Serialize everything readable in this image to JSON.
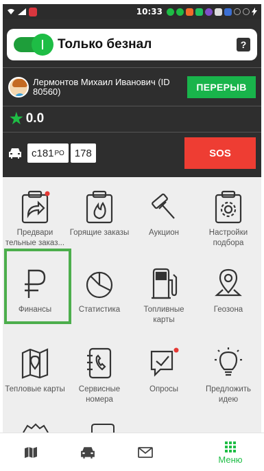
{
  "status": {
    "time": "10:33"
  },
  "toggle": {
    "label": "Только безнал",
    "help": "?"
  },
  "driver": {
    "name": "Лермонтов Михаил Иванович (ID 80560)",
    "break_label": "ПЕРЕРЫВ"
  },
  "rating": {
    "value": "0.0"
  },
  "car": {
    "plate_main": "с181",
    "plate_suffix": "РО",
    "plate_number": "178",
    "sos_label": "SOS"
  },
  "menu": {
    "items": [
      {
        "label": "Предвари тельные заказ...",
        "icon": "clipboard-arrow-icon",
        "badge": true
      },
      {
        "label": "Горящие заказы",
        "icon": "clipboard-fire-icon",
        "badge": false
      },
      {
        "label": "Аукцион",
        "icon": "gavel-icon",
        "badge": false
      },
      {
        "label": "Настройки подбора",
        "icon": "clipboard-gear-icon",
        "badge": false
      },
      {
        "label": "Финансы",
        "icon": "ruble-icon",
        "badge": false
      },
      {
        "label": "Статистика",
        "icon": "pie-chart-icon",
        "badge": false
      },
      {
        "label": "Топливные карты",
        "icon": "fuel-pump-icon",
        "badge": false
      },
      {
        "label": "Геозона",
        "icon": "location-pin-icon",
        "badge": false
      },
      {
        "label": "Тепловые карты",
        "icon": "heat-map-icon",
        "badge": false
      },
      {
        "label": "Сервисные номера",
        "icon": "phone-book-icon",
        "badge": false
      },
      {
        "label": "Опросы",
        "icon": "survey-icon",
        "badge": true
      },
      {
        "label": "Предложить идею",
        "icon": "lightbulb-icon",
        "badge": false
      }
    ]
  },
  "nav": {
    "menu_label": "Меню"
  },
  "colors": {
    "accent": "#1ebd45",
    "sos": "#ee3d33",
    "header": "#2e2e2e",
    "badge": "#e53935",
    "highlight": "#4cae4c"
  }
}
